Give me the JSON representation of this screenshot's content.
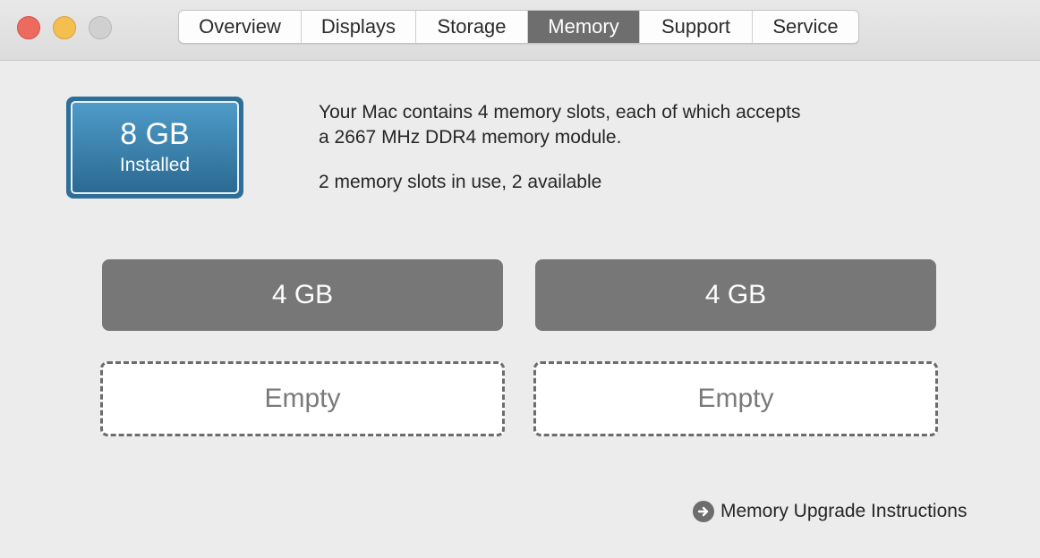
{
  "tabs": [
    {
      "label": "Overview",
      "active": false
    },
    {
      "label": "Displays",
      "active": false
    },
    {
      "label": "Storage",
      "active": false
    },
    {
      "label": "Memory",
      "active": true
    },
    {
      "label": "Support",
      "active": false
    },
    {
      "label": "Service",
      "active": false
    }
  ],
  "installed": {
    "size": "8 GB",
    "label": "Installed"
  },
  "description": {
    "line1": "Your Mac contains 4 memory slots, each of which accepts",
    "line2": "a 2667 MHz DDR4 memory module.",
    "usage": "2 memory slots in use, 2 available"
  },
  "slots": [
    {
      "label": "4 GB",
      "state": "filled"
    },
    {
      "label": "4 GB",
      "state": "filled"
    },
    {
      "label": "Empty",
      "state": "empty"
    },
    {
      "label": "Empty",
      "state": "empty"
    }
  ],
  "upgrade_link": {
    "label": "Memory Upgrade Instructions",
    "icon": "arrow-circle-right-icon"
  },
  "colors": {
    "badge": "#2d6f98",
    "slot_filled": "#777777",
    "tab_active": "#6e6e6e"
  }
}
